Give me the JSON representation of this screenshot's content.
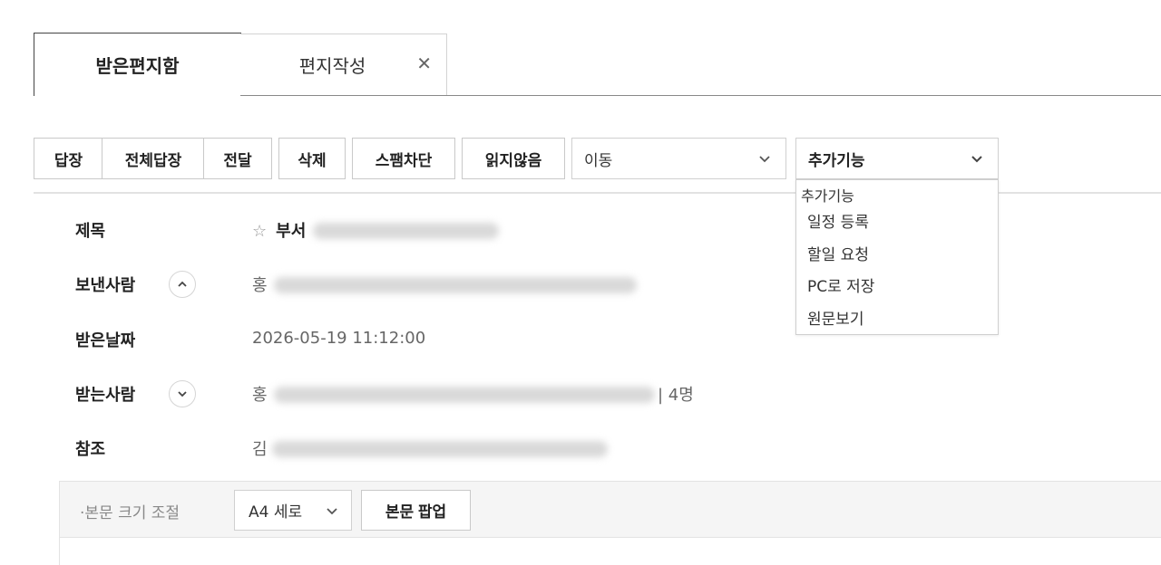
{
  "tabs": {
    "inbox_label": "받은편지함",
    "compose_label": "편지작성",
    "close_glyph": "✕"
  },
  "toolbar": {
    "reply": "답장",
    "reply_all": "전체답장",
    "forward": "전달",
    "delete": "삭제",
    "spam_block": "스팸차단",
    "mark_unread": "읽지않음",
    "move_select": "이동",
    "extra_select": "추가기능"
  },
  "dropdown": {
    "title": "추가기능",
    "items": [
      "일정 등록",
      "할일 요청",
      "PC로 저장",
      "원문보기"
    ]
  },
  "mail": {
    "subject_label": "제목",
    "subject_star": "☆",
    "subject_prefix": "부서",
    "sender_label": "보낸사람",
    "sender_prefix": "홍",
    "date_label": "받은날짜",
    "date_value": "2026-05-19 11:12:00",
    "recipients_label": "받는사람",
    "recipients_prefix": "홍",
    "recipients_count": "| 4명",
    "cc_label": "참조",
    "cc_prefix": "김"
  },
  "bodybar": {
    "size_label": "·본문 크기 조절",
    "size_select": "A4 세로",
    "popup_button": "본문 팝업"
  }
}
